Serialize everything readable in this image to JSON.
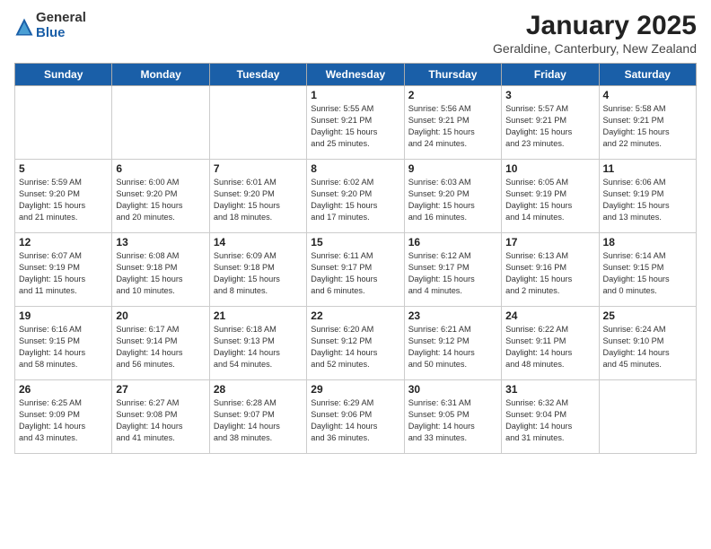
{
  "logo": {
    "general": "General",
    "blue": "Blue"
  },
  "header": {
    "month_title": "January 2025",
    "subtitle": "Geraldine, Canterbury, New Zealand"
  },
  "days_of_week": [
    "Sunday",
    "Monday",
    "Tuesday",
    "Wednesday",
    "Thursday",
    "Friday",
    "Saturday"
  ],
  "weeks": [
    [
      {
        "day": "",
        "info": ""
      },
      {
        "day": "",
        "info": ""
      },
      {
        "day": "",
        "info": ""
      },
      {
        "day": "1",
        "info": "Sunrise: 5:55 AM\nSunset: 9:21 PM\nDaylight: 15 hours\nand 25 minutes."
      },
      {
        "day": "2",
        "info": "Sunrise: 5:56 AM\nSunset: 9:21 PM\nDaylight: 15 hours\nand 24 minutes."
      },
      {
        "day": "3",
        "info": "Sunrise: 5:57 AM\nSunset: 9:21 PM\nDaylight: 15 hours\nand 23 minutes."
      },
      {
        "day": "4",
        "info": "Sunrise: 5:58 AM\nSunset: 9:21 PM\nDaylight: 15 hours\nand 22 minutes."
      }
    ],
    [
      {
        "day": "5",
        "info": "Sunrise: 5:59 AM\nSunset: 9:20 PM\nDaylight: 15 hours\nand 21 minutes."
      },
      {
        "day": "6",
        "info": "Sunrise: 6:00 AM\nSunset: 9:20 PM\nDaylight: 15 hours\nand 20 minutes."
      },
      {
        "day": "7",
        "info": "Sunrise: 6:01 AM\nSunset: 9:20 PM\nDaylight: 15 hours\nand 18 minutes."
      },
      {
        "day": "8",
        "info": "Sunrise: 6:02 AM\nSunset: 9:20 PM\nDaylight: 15 hours\nand 17 minutes."
      },
      {
        "day": "9",
        "info": "Sunrise: 6:03 AM\nSunset: 9:20 PM\nDaylight: 15 hours\nand 16 minutes."
      },
      {
        "day": "10",
        "info": "Sunrise: 6:05 AM\nSunset: 9:19 PM\nDaylight: 15 hours\nand 14 minutes."
      },
      {
        "day": "11",
        "info": "Sunrise: 6:06 AM\nSunset: 9:19 PM\nDaylight: 15 hours\nand 13 minutes."
      }
    ],
    [
      {
        "day": "12",
        "info": "Sunrise: 6:07 AM\nSunset: 9:19 PM\nDaylight: 15 hours\nand 11 minutes."
      },
      {
        "day": "13",
        "info": "Sunrise: 6:08 AM\nSunset: 9:18 PM\nDaylight: 15 hours\nand 10 minutes."
      },
      {
        "day": "14",
        "info": "Sunrise: 6:09 AM\nSunset: 9:18 PM\nDaylight: 15 hours\nand 8 minutes."
      },
      {
        "day": "15",
        "info": "Sunrise: 6:11 AM\nSunset: 9:17 PM\nDaylight: 15 hours\nand 6 minutes."
      },
      {
        "day": "16",
        "info": "Sunrise: 6:12 AM\nSunset: 9:17 PM\nDaylight: 15 hours\nand 4 minutes."
      },
      {
        "day": "17",
        "info": "Sunrise: 6:13 AM\nSunset: 9:16 PM\nDaylight: 15 hours\nand 2 minutes."
      },
      {
        "day": "18",
        "info": "Sunrise: 6:14 AM\nSunset: 9:15 PM\nDaylight: 15 hours\nand 0 minutes."
      }
    ],
    [
      {
        "day": "19",
        "info": "Sunrise: 6:16 AM\nSunset: 9:15 PM\nDaylight: 14 hours\nand 58 minutes."
      },
      {
        "day": "20",
        "info": "Sunrise: 6:17 AM\nSunset: 9:14 PM\nDaylight: 14 hours\nand 56 minutes."
      },
      {
        "day": "21",
        "info": "Sunrise: 6:18 AM\nSunset: 9:13 PM\nDaylight: 14 hours\nand 54 minutes."
      },
      {
        "day": "22",
        "info": "Sunrise: 6:20 AM\nSunset: 9:12 PM\nDaylight: 14 hours\nand 52 minutes."
      },
      {
        "day": "23",
        "info": "Sunrise: 6:21 AM\nSunset: 9:12 PM\nDaylight: 14 hours\nand 50 minutes."
      },
      {
        "day": "24",
        "info": "Sunrise: 6:22 AM\nSunset: 9:11 PM\nDaylight: 14 hours\nand 48 minutes."
      },
      {
        "day": "25",
        "info": "Sunrise: 6:24 AM\nSunset: 9:10 PM\nDaylight: 14 hours\nand 45 minutes."
      }
    ],
    [
      {
        "day": "26",
        "info": "Sunrise: 6:25 AM\nSunset: 9:09 PM\nDaylight: 14 hours\nand 43 minutes."
      },
      {
        "day": "27",
        "info": "Sunrise: 6:27 AM\nSunset: 9:08 PM\nDaylight: 14 hours\nand 41 minutes."
      },
      {
        "day": "28",
        "info": "Sunrise: 6:28 AM\nSunset: 9:07 PM\nDaylight: 14 hours\nand 38 minutes."
      },
      {
        "day": "29",
        "info": "Sunrise: 6:29 AM\nSunset: 9:06 PM\nDaylight: 14 hours\nand 36 minutes."
      },
      {
        "day": "30",
        "info": "Sunrise: 6:31 AM\nSunset: 9:05 PM\nDaylight: 14 hours\nand 33 minutes."
      },
      {
        "day": "31",
        "info": "Sunrise: 6:32 AM\nSunset: 9:04 PM\nDaylight: 14 hours\nand 31 minutes."
      },
      {
        "day": "",
        "info": ""
      }
    ]
  ]
}
